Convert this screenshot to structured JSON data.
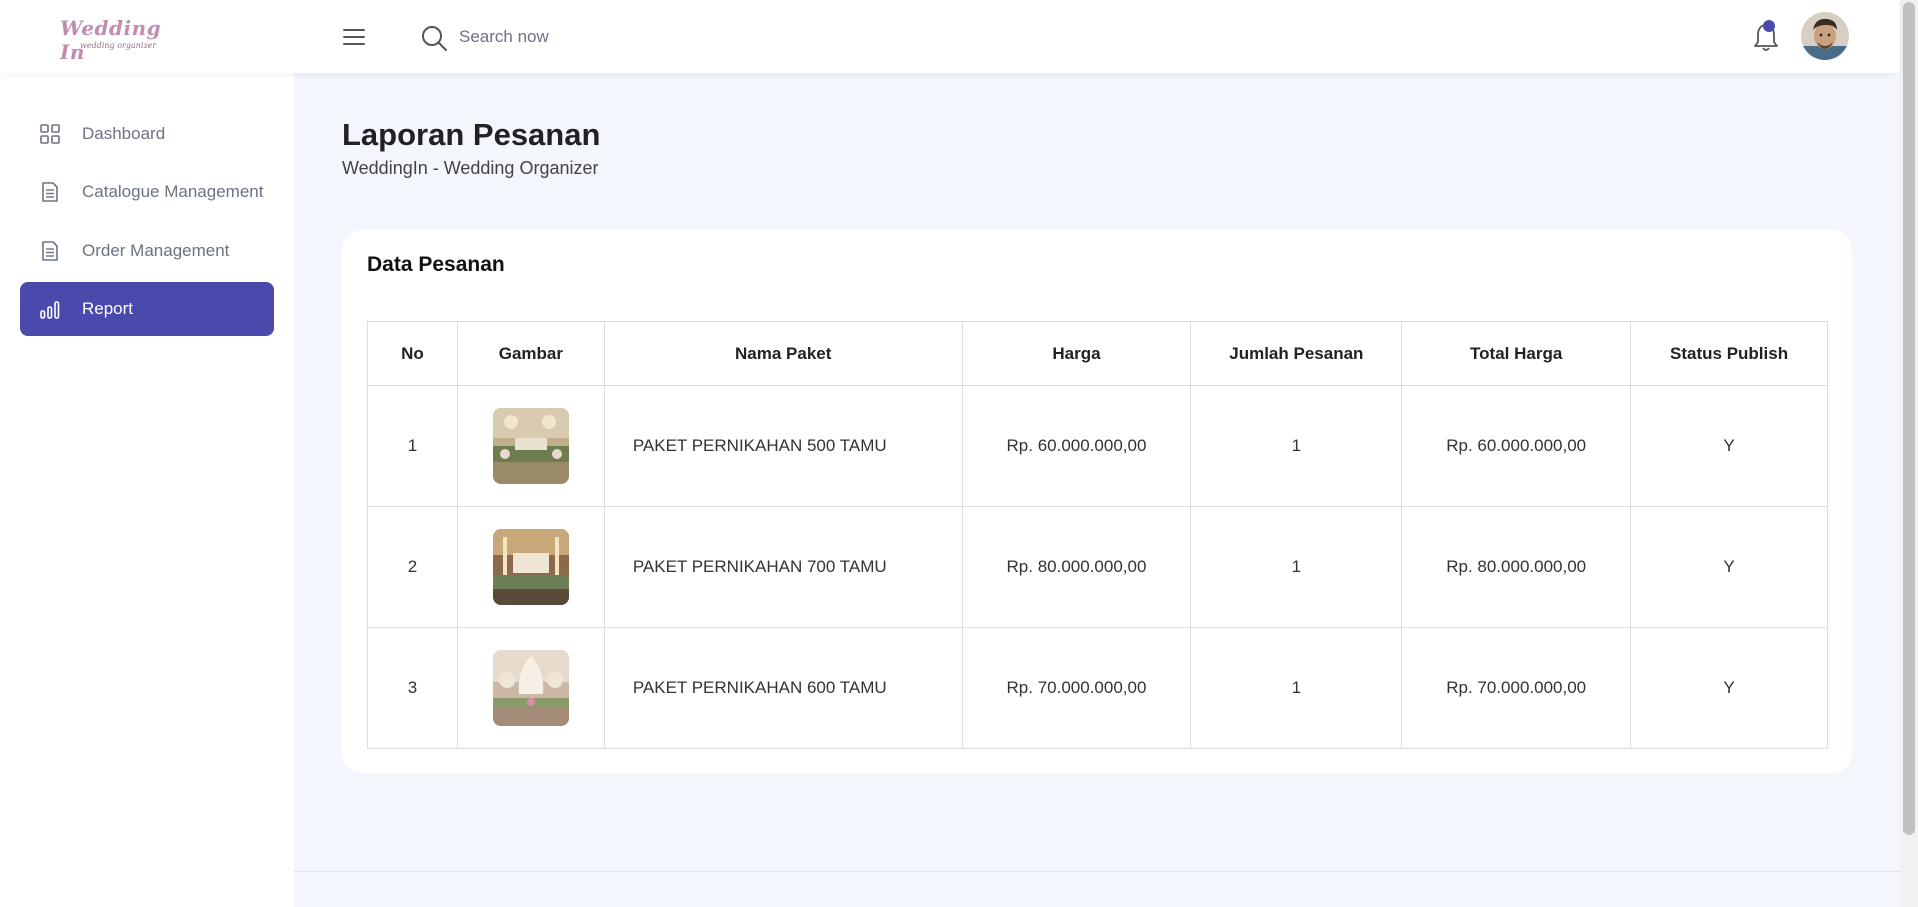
{
  "header": {
    "logo_main": "Wedding In",
    "logo_sub": "wedding organizer",
    "search_placeholder": "Search now"
  },
  "sidebar": {
    "items": [
      {
        "label": "Dashboard",
        "icon": "grid-icon"
      },
      {
        "label": "Catalogue Management",
        "icon": "document-icon"
      },
      {
        "label": "Order Management",
        "icon": "document-icon"
      },
      {
        "label": "Report",
        "icon": "bar-chart-icon",
        "active": true
      }
    ]
  },
  "page": {
    "title": "Laporan Pesanan",
    "subtitle": "WeddingIn - Wedding Organizer"
  },
  "card": {
    "title": "Data Pesanan"
  },
  "table": {
    "headers": [
      "No",
      "Gambar",
      "Nama Paket",
      "Harga",
      "Jumlah Pesanan",
      "Total Harga",
      "Status Publish"
    ],
    "rows": [
      {
        "no": "1",
        "image": "wedding-decor-thumbnail",
        "name": "PAKET PERNIKAHAN 500 TAMU",
        "price": "Rp. 60.000.000,00",
        "qty": "1",
        "total": "Rp. 60.000.000,00",
        "status": "Y"
      },
      {
        "no": "2",
        "image": "wedding-decor-thumbnail",
        "name": "PAKET PERNIKAHAN 700 TAMU",
        "price": "Rp. 80.000.000,00",
        "qty": "1",
        "total": "Rp. 80.000.000,00",
        "status": "Y"
      },
      {
        "no": "3",
        "image": "wedding-decor-thumbnail",
        "name": "PAKET PERNIKAHAN 600 TAMU",
        "price": "Rp. 70.000.000,00",
        "qty": "1",
        "total": "Rp. 70.000.000,00",
        "status": "Y"
      }
    ]
  },
  "colors": {
    "accent": "#4b49ac",
    "background": "#f3f6fd",
    "logo": "#c28bb0"
  }
}
